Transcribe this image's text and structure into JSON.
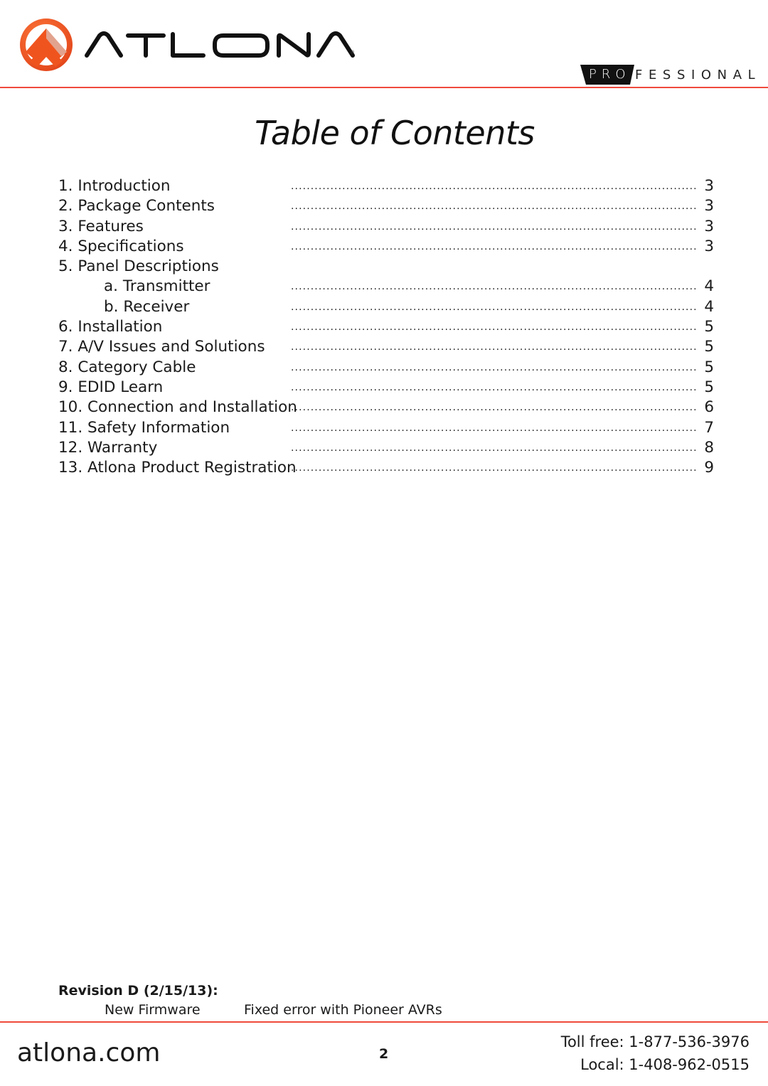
{
  "header": {
    "brand": "ATLONA",
    "registered_mark": "®",
    "badge_highlight": "PRO",
    "badge_rest": "FESSIONAL",
    "brand_color": "#f04a3c"
  },
  "title": "Table of Contents",
  "toc": [
    {
      "label": "1. Introduction",
      "page": "3",
      "sub": false
    },
    {
      "label": "2. Package Contents",
      "page": "3",
      "sub": false
    },
    {
      "label": "3. Features",
      "page": "3",
      "sub": false
    },
    {
      "label": "4. Specifications",
      "page": "3",
      "sub": false
    },
    {
      "label": "5. Panel Descriptions",
      "page": null,
      "sub": false
    },
    {
      "label": "a. Transmitter",
      "page": "4",
      "sub": true
    },
    {
      "label": "b. Receiver",
      "page": "4",
      "sub": true
    },
    {
      "label": "6. Installation",
      "page": "5",
      "sub": false
    },
    {
      "label": "7. A/V Issues and Solutions",
      "page": "5",
      "sub": false
    },
    {
      "label": "8. Category Cable",
      "page": "5",
      "sub": false
    },
    {
      "label": "9. EDID Learn",
      "page": "5",
      "sub": false
    },
    {
      "label": "10. Connection and Installation",
      "page": "6",
      "sub": false
    },
    {
      "label": "11. Safety Information",
      "page": "7",
      "sub": false
    },
    {
      "label": "12. Warranty",
      "page": "8",
      "sub": false
    },
    {
      "label": "13. Atlona Product Registration",
      "page": "9",
      "sub": false
    }
  ],
  "revision": {
    "title": "Revision D (2/15/13):",
    "item": "New Firmware",
    "description": "Fixed error with Pioneer AVRs"
  },
  "footer": {
    "website": "atlona.com",
    "page_number": "2",
    "toll_free": "Toll free: 1-877-536-3976",
    "local": "Local: 1-408-962-0515"
  }
}
